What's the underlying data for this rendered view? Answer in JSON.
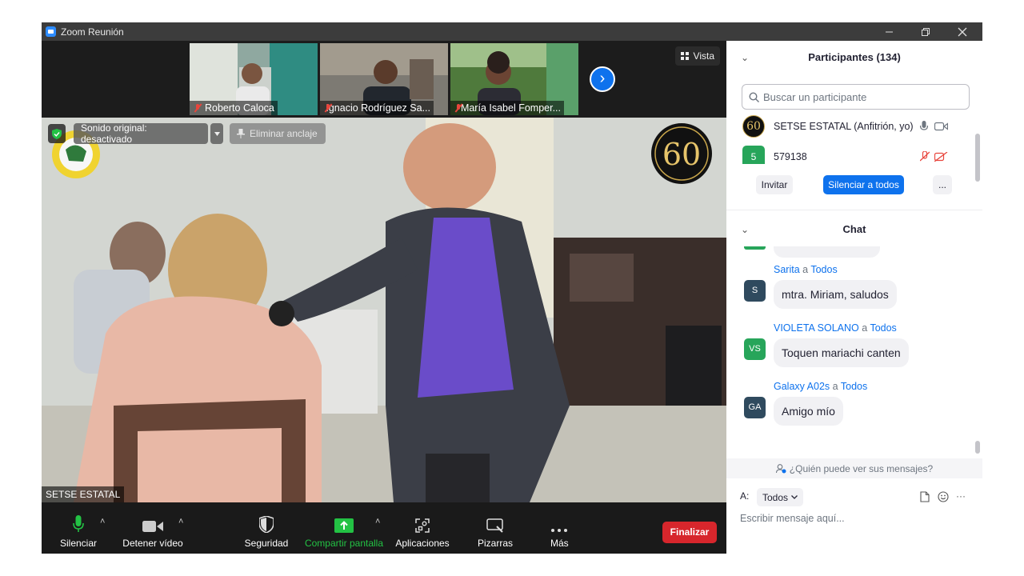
{
  "window": {
    "title": "Zoom Reunión"
  },
  "gallery": {
    "thumbnails": [
      {
        "name": "Roberto Caloca"
      },
      {
        "name": "Ignacio Rodríguez Sa..."
      },
      {
        "name": "María Isabel Fomper..."
      }
    ],
    "view_label": "Vista"
  },
  "main_video": {
    "original_sound": "Sonido original: desactivado",
    "unpin_label": "Eliminar anclaje",
    "badge_text": "60",
    "speaker_name": "SETSE ESTATAL"
  },
  "toolbar": {
    "mute_label": "Silenciar",
    "video_label": "Detener vídeo",
    "security_label": "Seguridad",
    "share_label": "Compartir pantalla",
    "apps_label": "Aplicaciones",
    "whiteboard_label": "Pizarras",
    "more_label": "Más",
    "end_label": "Finalizar"
  },
  "participants": {
    "header": "Participantes (134)",
    "search_placeholder": "Buscar un participante",
    "list": [
      {
        "name": "SETSE ESTATAL (Anfitrión, yo)",
        "avatar": "60"
      },
      {
        "name": "579138",
        "avatar": "5"
      }
    ],
    "invite_label": "Invitar",
    "mute_all_label": "Silenciar a todos",
    "more_label": "..."
  },
  "chat": {
    "header": "Chat",
    "messages": [
      {
        "sender": "Sarita",
        "to_word": "a",
        "recipient": "Todos",
        "initials": "S",
        "text": "mtra. Miriam, saludos",
        "avatar_color": "#2f4a5e"
      },
      {
        "sender": "VIOLETA SOLANO",
        "to_word": "a",
        "recipient": "Todos",
        "initials": "VS",
        "text": "Toquen mariachi canten",
        "avatar_color": "#27a55a"
      },
      {
        "sender": "Galaxy A02s",
        "to_word": "a",
        "recipient": "Todos",
        "initials": "GA",
        "text": "Amigo mío",
        "avatar_color": "#2f4a5e"
      }
    ],
    "visibility_note": "¿Quién puede ver sus mensajes?",
    "to_label": "A:",
    "recipient_select": "Todos",
    "input_placeholder": "Escribir mensaje aquí...",
    "composer_more": "···"
  },
  "colors": {
    "accent": "#0e72ed",
    "end": "#d7262c",
    "share": "#23c244"
  }
}
